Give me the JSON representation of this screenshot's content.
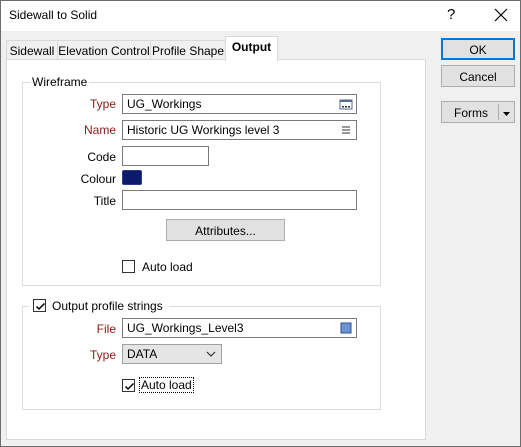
{
  "window": {
    "title": "Sidewall to Solid",
    "help_glyph": "?",
    "close_glyph": "✕"
  },
  "tabs": [
    {
      "label": "Sidewall",
      "active": false
    },
    {
      "label": "Elevation Control",
      "active": false
    },
    {
      "label": "Profile Shape",
      "active": false
    },
    {
      "label": "Output",
      "active": true
    }
  ],
  "wireframe": {
    "group_label": "Wireframe",
    "type_label": "Type",
    "type_value": "UG_Workings",
    "name_label": "Name",
    "name_value": "Historic UG Workings level 3",
    "code_label": "Code",
    "code_value": "",
    "colour_label": "Colour",
    "colour_value": "#0b1a6b",
    "title_label": "Title",
    "title_value": "",
    "attributes_button": "Attributes...",
    "auto_load_label": "Auto load",
    "auto_load_checked": false
  },
  "output_profile": {
    "group_label": "Output profile strings",
    "enabled": true,
    "file_label": "File",
    "file_value": "UG_Workings_Level3",
    "type_label": "Type",
    "type_value": "DATA",
    "auto_load_label": "Auto load",
    "auto_load_checked": true
  },
  "buttons": {
    "ok_label": "OK",
    "cancel_label": "Cancel",
    "forms_label": "Forms"
  },
  "icons": {
    "type_browse": "browse-icon",
    "name_list": "list-icon",
    "file_browse": "file-icon",
    "dropdown": "chevron-down-icon"
  }
}
